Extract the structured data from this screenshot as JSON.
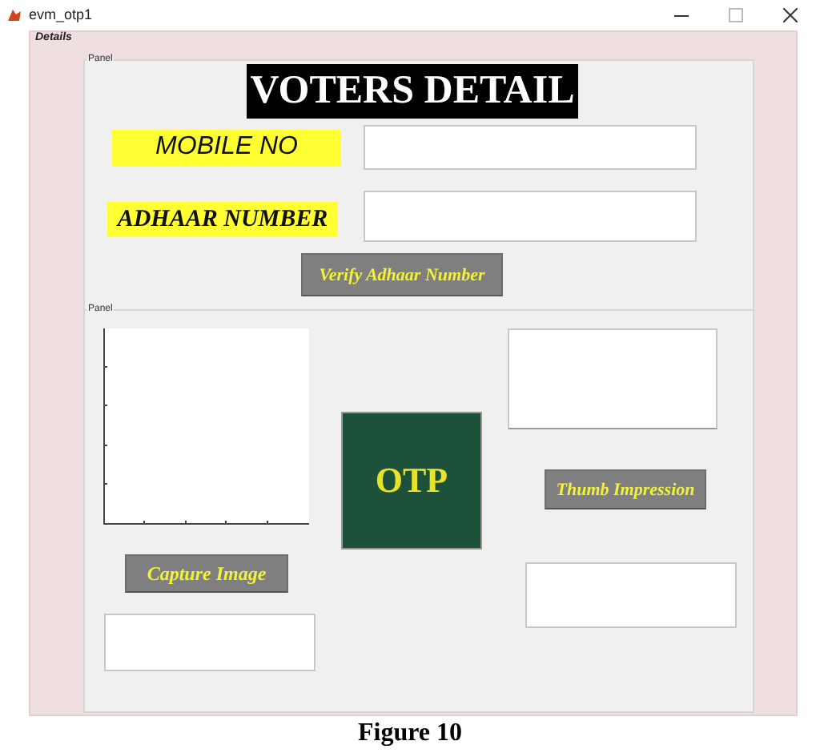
{
  "window": {
    "title": "evm_otp1"
  },
  "details_panel": {
    "title": "Details",
    "voter_panel": {
      "title": "Panel",
      "heading": "VOTERS DETAIL",
      "fields": [
        {
          "label": "MOBILE NO",
          "kind": "sans"
        },
        {
          "label": "ADHAAR NUMBER",
          "kind": "serif"
        }
      ],
      "verify_button": "Verify Adhaar Number"
    },
    "capture_panel": {
      "title": "Panel",
      "capture_button": "Capture Image",
      "otp_button": "OTP",
      "thumb_button": "Thumb Impression"
    }
  },
  "caption": "Figure 10"
}
